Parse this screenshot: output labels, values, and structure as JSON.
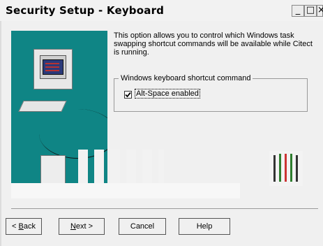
{
  "window": {
    "title": "Security Setup - Keyboard",
    "min_glyph": "_",
    "max_glyph": "□",
    "close_glyph": "×"
  },
  "content": {
    "description": "This option allows you to control which Windows task swapping shortcut commands will be available while Citect is running.",
    "group_label": "Windows keyboard shortcut command",
    "checkbox_label": "Alt-Space enabled",
    "checkbox_checked": true
  },
  "buttons": {
    "back_prefix": "<",
    "back_hotkey": "B",
    "back_rest": "ack",
    "next_hotkey": "N",
    "next_rest": "ext >",
    "cancel": "Cancel",
    "help": "Help"
  },
  "colors": {
    "art_background": "#0f8585",
    "window_background": "#f0f0f0"
  },
  "icons": [
    "computer-illustration",
    "checkmark-icon",
    "wizard-thumbnail-icon"
  ]
}
